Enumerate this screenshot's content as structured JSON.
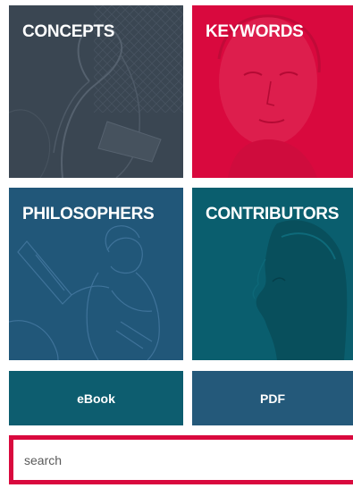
{
  "tiles": {
    "concepts": {
      "label": "CONCEPTS",
      "color": "#3a4652"
    },
    "keywords": {
      "label": "KEYWORDS",
      "color": "#d9093e"
    },
    "philosophers": {
      "label": "PHILOSOPHERS",
      "color": "#215779"
    },
    "contributors": {
      "label": "CONTRIBUTORS",
      "color": "#0a5e6e"
    }
  },
  "buttons": {
    "ebook": {
      "label": "eBook",
      "color": "#0d5d6f"
    },
    "pdf": {
      "label": "PDF",
      "color": "#24597a"
    }
  },
  "search": {
    "placeholder": "search",
    "value": "",
    "border_color": "#d9093e"
  }
}
